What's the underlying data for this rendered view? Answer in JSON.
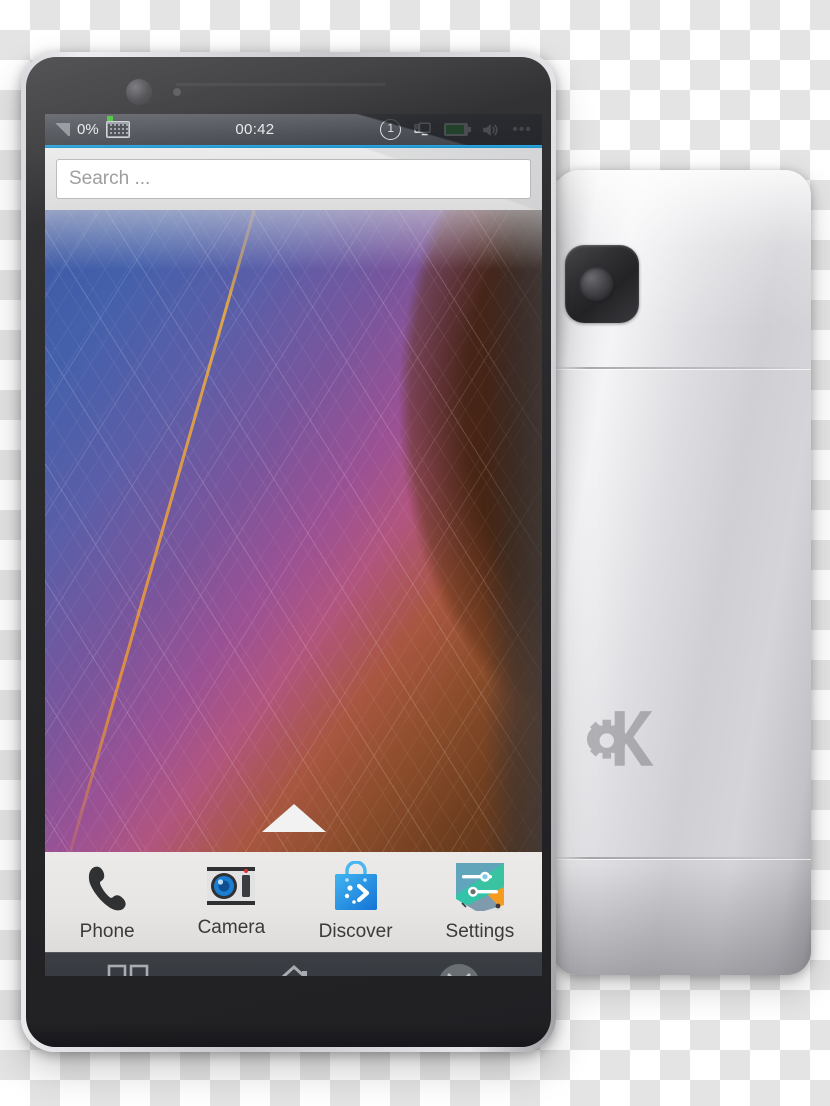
{
  "device": {
    "front_label": "phone-front-kde-plasma-mobile",
    "back_label": "phone-back-silver"
  },
  "status_bar": {
    "battery_percent": "0%",
    "time": "00:42",
    "notification_count": "1",
    "ellipsis": "•••",
    "icons": [
      "signal-icon",
      "keyboard-icon",
      "circle-one-icon",
      "device-connection-icon",
      "battery-icon",
      "volume-icon",
      "ellipsis-icon"
    ],
    "accent_color": "#2aa7e0"
  },
  "search": {
    "placeholder": "Search ...",
    "value": ""
  },
  "dock": {
    "items": [
      {
        "label": "Phone",
        "icon": "phone-icon"
      },
      {
        "label": "Camera",
        "icon": "camera-icon"
      },
      {
        "label": "Discover",
        "icon": "discover-icon"
      },
      {
        "label": "Settings",
        "icon": "settings-icon"
      }
    ]
  },
  "nav_bar": {
    "items": [
      {
        "name": "app-grid",
        "icon": "grid-icon"
      },
      {
        "name": "home",
        "icon": "home-icon"
      },
      {
        "name": "close",
        "icon": "close-circle-icon"
      }
    ]
  },
  "home_screen": {
    "drawer_handle": "up-triangle-icon"
  },
  "branding": {
    "back_logo": "kde-logo"
  }
}
